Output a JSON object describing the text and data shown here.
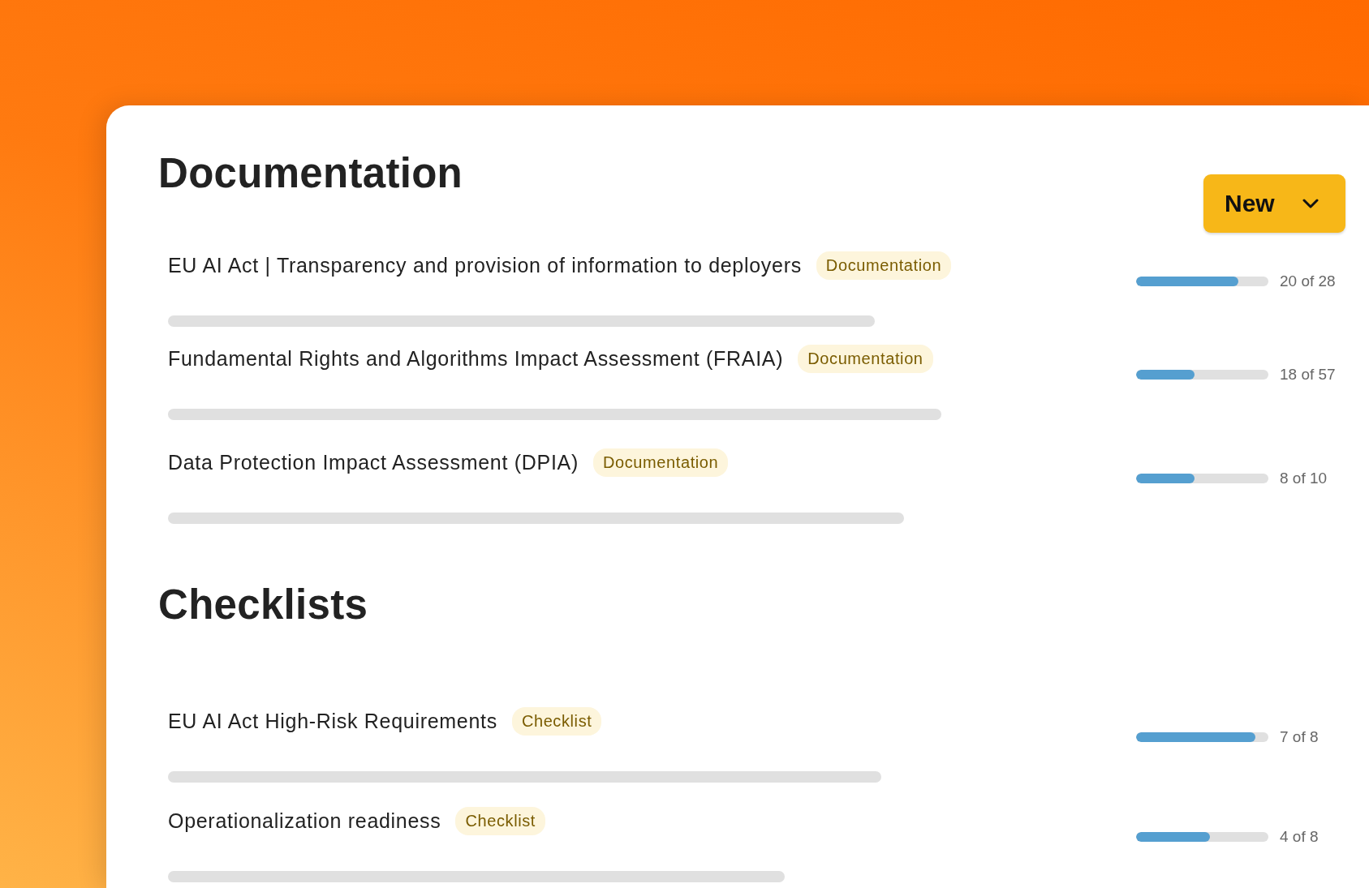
{
  "sections": [
    {
      "title": "Documentation",
      "new_button": {
        "label": "New"
      },
      "items": [
        {
          "title": "EU AI Act | Transparency and provision of information to deployers",
          "badge": "Documentation",
          "level": 0.77,
          "reading": "20 of 28"
        },
        {
          "title": "Fundamental Rights and Algorithms Impact Assessment (FRAIA)",
          "badge": "Documentation",
          "level": 0.44,
          "reading": "18 of 57"
        },
        {
          "title": "Data Protection Impact Assessment (DPIA)",
          "badge": "Documentation",
          "level": 0.44,
          "reading": "8 of 10"
        }
      ]
    },
    {
      "title": "Checklists",
      "items": [
        {
          "title": "EU AI Act High-Risk Requirements",
          "badge": "Checklist",
          "level": 0.9,
          "reading": "7 of 8"
        },
        {
          "title": "Operationalization readiness",
          "badge": "Checklist",
          "level": 0.56,
          "reading": "4 of 8"
        }
      ]
    }
  ]
}
